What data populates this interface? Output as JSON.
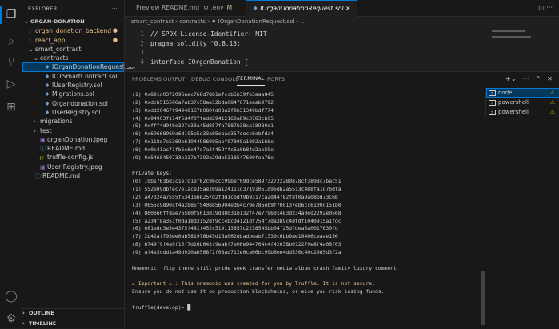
{
  "activity": {
    "icons": [
      "files-icon",
      "search-icon",
      "source-control-icon",
      "run-debug-icon",
      "extensions-icon",
      "account-icon",
      "settings-icon"
    ]
  },
  "explorer": {
    "title": "EXPLORER",
    "more": "···",
    "root": "ORGAN-DONATION",
    "items": [
      {
        "label": "organ_donation_backend",
        "depth": 1,
        "chev": "›",
        "icon": "",
        "mod": true
      },
      {
        "label": "react_app",
        "depth": 1,
        "chev": "›",
        "icon": "",
        "mod": true
      },
      {
        "label": "smart_contract",
        "depth": 1,
        "chev": "⌄",
        "icon": ""
      },
      {
        "label": "contracts",
        "depth": 2,
        "chev": "⌄",
        "icon": ""
      },
      {
        "label": "IOrganDonationRequest.sol",
        "depth": 3,
        "chev": "",
        "icon": "♦",
        "sel": true
      },
      {
        "label": "IOTSmartContract.sol",
        "depth": 3,
        "chev": "",
        "icon": "♦"
      },
      {
        "label": "IUserRegistry.sol",
        "depth": 3,
        "chev": "",
        "icon": "♦"
      },
      {
        "label": "Migrations.sol",
        "depth": 3,
        "chev": "",
        "icon": "♦"
      },
      {
        "label": "Organdonation.sol",
        "depth": 3,
        "chev": "",
        "icon": "♦"
      },
      {
        "label": "UserRegistry.sol",
        "depth": 3,
        "chev": "",
        "icon": "♦"
      },
      {
        "label": "migrations",
        "depth": 2,
        "chev": "›",
        "icon": ""
      },
      {
        "label": "test",
        "depth": 2,
        "chev": "›",
        "icon": ""
      },
      {
        "label": "organDonation.jpeg",
        "depth": 2,
        "chev": "",
        "icon": "▣"
      },
      {
        "label": "README.md",
        "depth": 2,
        "chev": "",
        "icon": "ⓘ"
      },
      {
        "label": "truffle-config.js",
        "depth": 2,
        "chev": "",
        "icon": "JS"
      },
      {
        "label": "User Registry.jpeg",
        "depth": 2,
        "chev": "",
        "icon": "▣"
      },
      {
        "label": "README.md",
        "depth": 1,
        "chev": "",
        "icon": "ⓘ"
      }
    ],
    "outline": "OUTLINE",
    "timeline": "TIMELINE"
  },
  "tabs": [
    {
      "label": "Preview README.md",
      "icon": "",
      "active": false
    },
    {
      "label": ".env",
      "icon": "⚙",
      "suffix": "M",
      "active": false
    },
    {
      "label": "IOrganDonationRequest.sol",
      "icon": "♦",
      "close": "✕",
      "active": true
    }
  ],
  "tab_actions": "◫ ···",
  "breadcrumb": "smart_contract › contracts › ♦ IOrganDonationRequest.sol › ...",
  "editor": {
    "lines": [
      {
        "n": "1",
        "text": "// SPDX-License-Identifier: MIT",
        "cls": "cmt"
      },
      {
        "n": "2",
        "text": "pragma solidity ^0.8.13;",
        "cls": ""
      },
      {
        "n": "3",
        "text": "",
        "cls": ""
      },
      {
        "n": "4",
        "text": "interface IOrganDonation {",
        "cls": ""
      }
    ]
  },
  "panel": {
    "tabs": [
      "PROBLEMS",
      "OUTPUT",
      "DEBUG CONSOLE",
      "TERMINAL",
      "PORTS"
    ],
    "active_tab": "TERMINAL",
    "actions": "+⌄ ··· ^ ✕"
  },
  "terminal": {
    "lines": [
      "(1) 0x891d0372096aec768d7861efccb5b39fb3aaa845",
      "(2) 0xdcb515506a7ab37c58aa12bda084f671eaab9792",
      "(3) 0xdd20467f94948167b080fd08a2f9b31349bdf774",
      "(4) 0x94903f114f5d4f07fedd29412160a89c3783cb05",
      "(5) 0xfff4d948e327c33a45d857fa7887b38ca18980d1",
      "(6) 0x69668969a6d195e5d33a05eaae357eecc6ebfda4",
      "(7) 0x118d7c5369e61944986985abf07808a1082a16be",
      "(8) 0x0c41ac71fb6c6e47e7a2f459ffc6a0b84d2ab59e",
      "(9) 0x5468459733e337b7392a29db5318547600fea76e",
      "",
      "Private Keys:",
      "(0) 10b1763bd1c1e7d1ef62c96ccc99bef09dce589732722280878cf3898c7bac51",
      "(1) 552e09dbfec7e1ace35ae269a124111d37191051d95db2a5513c488fa1d76dfa",
      "(2) a47324a7555f53416b8257d2fdd1cbdf9b9317ca2d44782f8f0a9a08bd73c6b",
      "(3) 0655c9890cf4a2885f5408856904edb4c79e786eb9f700137eb6cc6100c151b0",
      "(4) 860660ffdae76580f5013d19d88031b132f47e779601483d234a0ed2292e0568",
      "(5) a234f8a351f0da18d3152df9cc4bcd4121df754f7da389c4dfdf1040915a1fdc",
      "(6) 081edd3e5e4375f481f452c519113657c2238545bb04f25dfdea5a0017630fd",
      "(7) 2b42af793ee0ab581976b45d16a062dbadbeab71339c6bb9ae19406ceaae156",
      "(8) b749f9f4a9f15f7d26b043f9eabf7e06e944704c4f42038b012279e8f4a06f03",
      "(9) af4e3cdd1a49d920ab568f2f08ad712e0ca06bc99b6ee4dd530c40c29d5d3f2a",
      "",
      "Mnemonic: flip there still pride seek transfer media album crash family luxury comment",
      "",
      "⚠ Important ⚠ : This mnemonic was created for you by Truffle. It is not secure.",
      "Ensure you do not use it on production blockchains, or else you risk losing funds.",
      "",
      "truffle(develop)> █"
    ]
  },
  "terminal_list": [
    {
      "label": "node",
      "sel": true
    },
    {
      "label": "powershell",
      "sel": false
    },
    {
      "label": "powershell",
      "sel": false
    }
  ],
  "terminal_list_warn": "⚠"
}
